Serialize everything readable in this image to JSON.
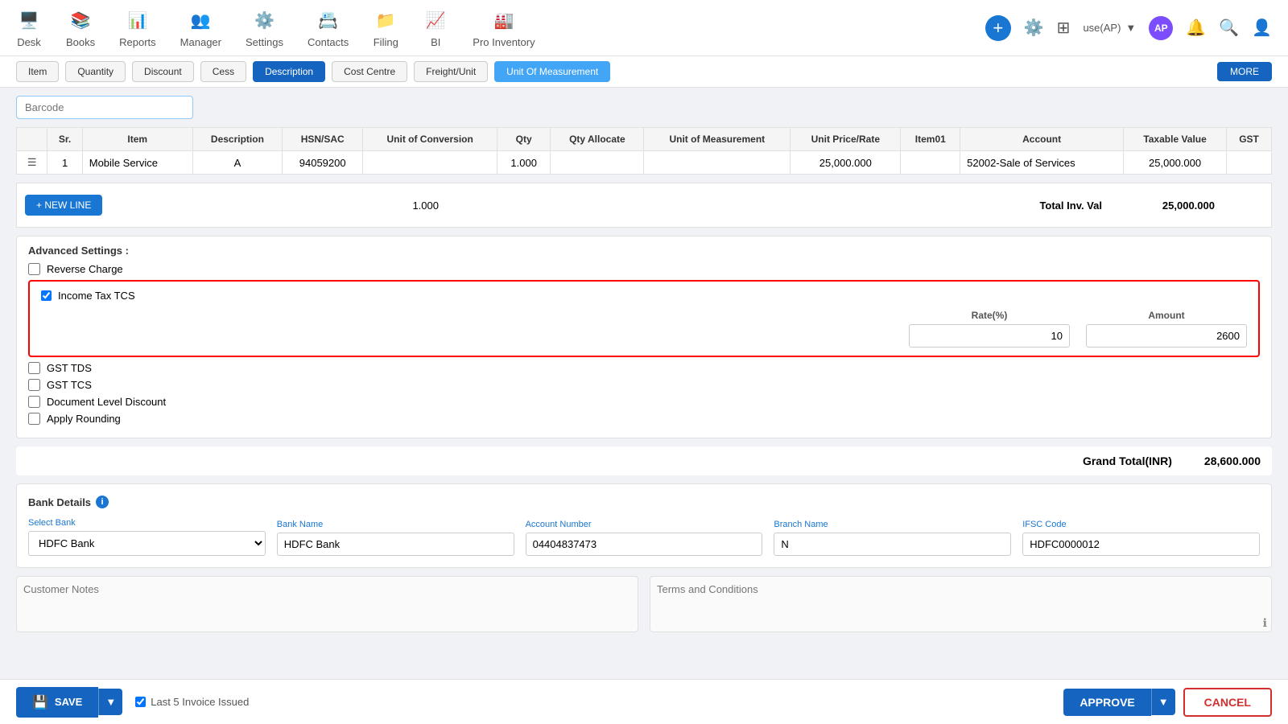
{
  "nav": {
    "items": [
      {
        "label": "Desk",
        "icon": "🖥️"
      },
      {
        "label": "Books",
        "icon": "📚"
      },
      {
        "label": "Reports",
        "icon": "📊"
      },
      {
        "label": "Manager",
        "icon": "👥"
      },
      {
        "label": "Settings",
        "icon": "⚙️"
      },
      {
        "label": "Contacts",
        "icon": "📇"
      },
      {
        "label": "Filing",
        "icon": "📁"
      },
      {
        "label": "BI",
        "icon": "📈"
      },
      {
        "label": "Pro Inventory",
        "icon": "🏭"
      }
    ],
    "user": "use(AP)",
    "plus_label": "+"
  },
  "tabs": [
    {
      "label": "Item",
      "active": false
    },
    {
      "label": "Quantity",
      "active": false
    },
    {
      "label": "Discount",
      "active": false
    },
    {
      "label": "Cess",
      "active": false
    },
    {
      "label": "Description",
      "active": true
    },
    {
      "label": "Cost Centre",
      "active": false
    },
    {
      "label": "Freight/Unit",
      "active": false
    },
    {
      "label": "Unit Of Measurement",
      "active": true
    }
  ],
  "more_label": "MORE",
  "barcode_placeholder": "Barcode",
  "table": {
    "columns": [
      "Sr.",
      "Item",
      "Description",
      "HSN/SAC",
      "Unit of Conversion",
      "Qty",
      "Qty Allocate",
      "Unit of Measurement",
      "Unit Price/Rate",
      "Item01",
      "Account",
      "Taxable Value",
      "GST"
    ],
    "rows": [
      {
        "sr": "1",
        "item": "Mobile Service",
        "description": "A",
        "hsn_sac": "94059200",
        "unit_conversion": "",
        "qty": "1.000",
        "qty_allocate": "",
        "unit_measurement": "",
        "unit_price": "25,000.000",
        "item01": "",
        "account": "52002-Sale of Services",
        "taxable_value": "25,000.000",
        "gst": ""
      }
    ],
    "new_line_label": "+ NEW LINE",
    "total_qty": "1.000",
    "total_inv_val_label": "Total Inv. Val",
    "total_value": "25,000.000"
  },
  "advanced": {
    "title": "Advanced Settings :",
    "items": [
      {
        "label": "Reverse Charge",
        "checked": false
      },
      {
        "label": "Income Tax TCS",
        "checked": true,
        "highlighted": true
      },
      {
        "label": "GST TDS",
        "checked": false
      },
      {
        "label": "GST TCS",
        "checked": false
      },
      {
        "label": "Document Level Discount",
        "checked": false
      },
      {
        "label": "Apply Rounding",
        "checked": false
      }
    ],
    "tcs": {
      "rate_label": "Rate(%)",
      "amount_label": "Amount",
      "rate_value": "10",
      "amount_value": "2600"
    }
  },
  "grand_total": {
    "label": "Grand Total(INR)",
    "value": "28,600.000"
  },
  "bank": {
    "title": "Bank Details",
    "select_bank_label": "Select Bank",
    "select_bank_value": "HDFC Bank",
    "bank_name_label": "Bank Name",
    "bank_name_value": "HDFC Bank",
    "account_number_label": "Account Number",
    "account_number_value": "04404837473",
    "branch_name_label": "Branch Name",
    "branch_name_value": "N",
    "ifsc_label": "IFSC Code",
    "ifsc_value": "HDFC0000012"
  },
  "notes": {
    "customer_notes_placeholder": "Customer Notes",
    "terms_placeholder": "Terms and Conditions"
  },
  "bottom": {
    "save_label": "SAVE",
    "approve_label": "APPROVE",
    "cancel_label": "CANCEL",
    "last_invoice_label": "Last 5 Invoice Issued"
  }
}
